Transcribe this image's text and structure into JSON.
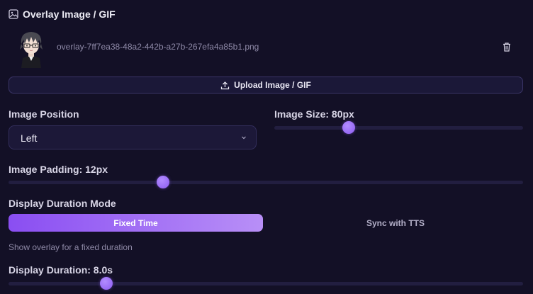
{
  "section": {
    "title": "Overlay Image / GIF"
  },
  "file": {
    "name": "overlay-7ff7ea38-48a2-442b-a27b-267efa4a85b1.png"
  },
  "upload": {
    "label": "Upload Image / GIF"
  },
  "image_position": {
    "label": "Image Position",
    "value": "Left"
  },
  "image_size": {
    "label": "Image Size: 80px",
    "level_fraction": 0.3
  },
  "image_padding": {
    "label": "Image Padding: 12px",
    "level_fraction": 0.3
  },
  "duration_mode": {
    "label": "Display Duration Mode",
    "options": [
      "Fixed Time",
      "Sync with TTS"
    ],
    "selected": "Fixed Time",
    "hint": "Show overlay for a fixed duration"
  },
  "display_duration": {
    "label": "Display Duration: 8.0s",
    "level_fraction": 0.19
  },
  "colors": {
    "background": "#131026",
    "accent": "#8c5cf0",
    "accent_light": "#b88ff7"
  }
}
